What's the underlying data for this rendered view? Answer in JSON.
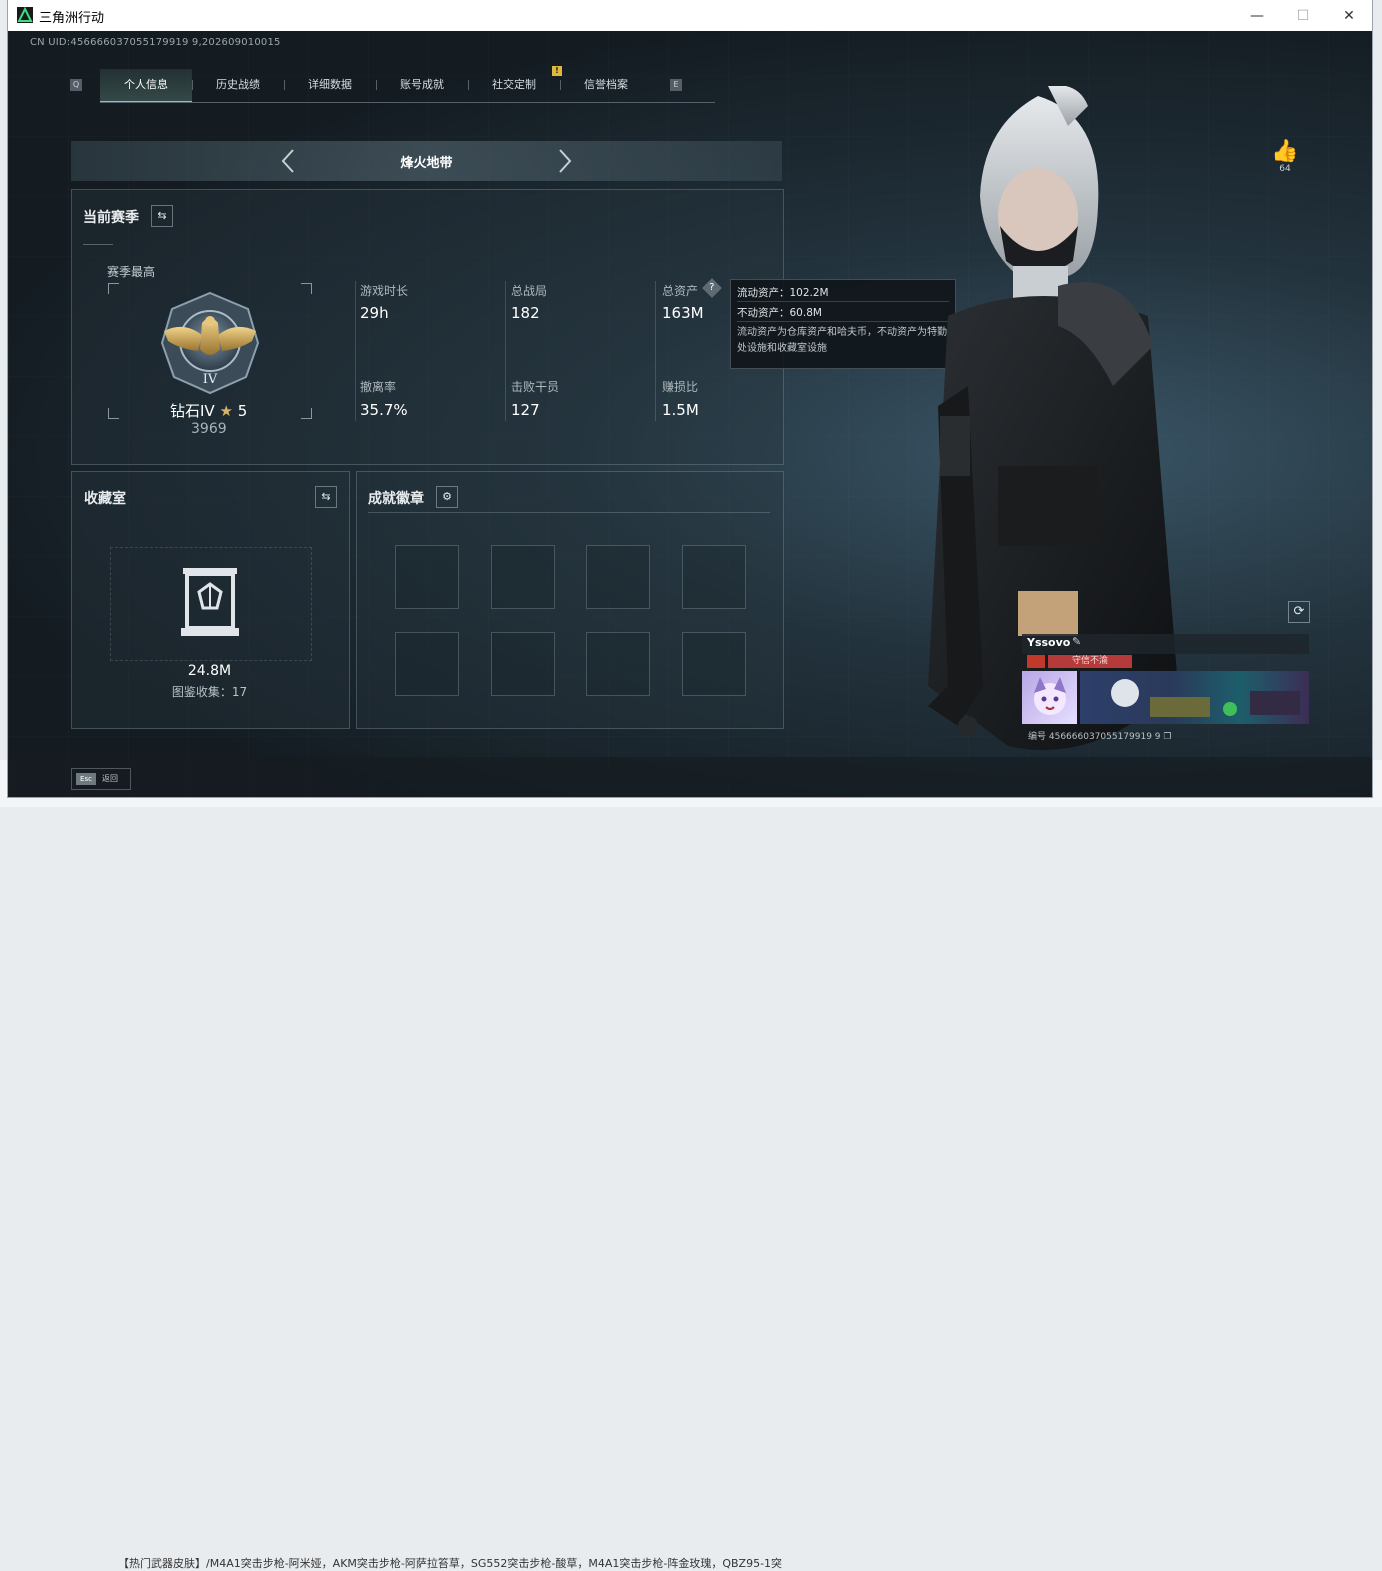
{
  "window": {
    "title": "三角洲行动",
    "minimize_glyph": "—",
    "maximize_glyph": "☐",
    "close_glyph": "✕"
  },
  "header": {
    "uid": "CN UID:456666037055179919 9,202609010015",
    "tab_key_left": "Q",
    "tab_key_right": "E"
  },
  "tabs": [
    {
      "label": "个人信息",
      "active": true
    },
    {
      "label": "历史战绩",
      "active": false
    },
    {
      "label": "详细数据",
      "active": false
    },
    {
      "label": "账号成就",
      "active": false
    },
    {
      "label": "社交定制",
      "active": false
    },
    {
      "label": "信誉档案",
      "active": false
    }
  ],
  "alert_badge": "!",
  "mode": {
    "label": "烽火地带"
  },
  "current_season": {
    "title": "当前赛季",
    "season_best_label": "赛季最高",
    "rank_name": "钻石IV",
    "rank_stars": "5",
    "rank_score": "3969",
    "rank_badge_numeral": "IV",
    "stats": [
      {
        "label": "游戏时长",
        "value": "29h"
      },
      {
        "label": "总战局",
        "value": "182"
      },
      {
        "label": "总资产",
        "value": "163M"
      },
      {
        "label": "撤离率",
        "value": "35.7%"
      },
      {
        "label": "击败干员",
        "value": "127"
      },
      {
        "label": "赚损比",
        "value": "1.5M"
      }
    ]
  },
  "tooltip": {
    "liquid": "流动资产：102.2M",
    "fixed": "不动资产：60.8M",
    "description": "流动资产为仓库资产和哈夫币，不动资产为特勤处设施和收藏室设施"
  },
  "collection": {
    "title": "收藏室",
    "value": "24.8M",
    "catalog": "图鉴收集：17"
  },
  "achievements": {
    "title": "成就徽章",
    "slots": 8
  },
  "like": {
    "count": "64"
  },
  "profile": {
    "name": "Yssovo",
    "motto": "守信不渝",
    "id_label": "编号 456666037055179919 9"
  },
  "bottom": {
    "esc_key": "Esc",
    "esc_label": "返回"
  },
  "background_text": "【热门武器皮肤】/M4A1突击步枪-阿米娅，AKM突击步枪-阿萨拉笞草，SG552突击步枪-酸草，M4A1突击步枪-阵金玫瑰，QBZ95-1突",
  "colors": {
    "accent_green": "#7ecf9a",
    "gold": "#d7b46a",
    "motto_red": "#b53b3b"
  }
}
